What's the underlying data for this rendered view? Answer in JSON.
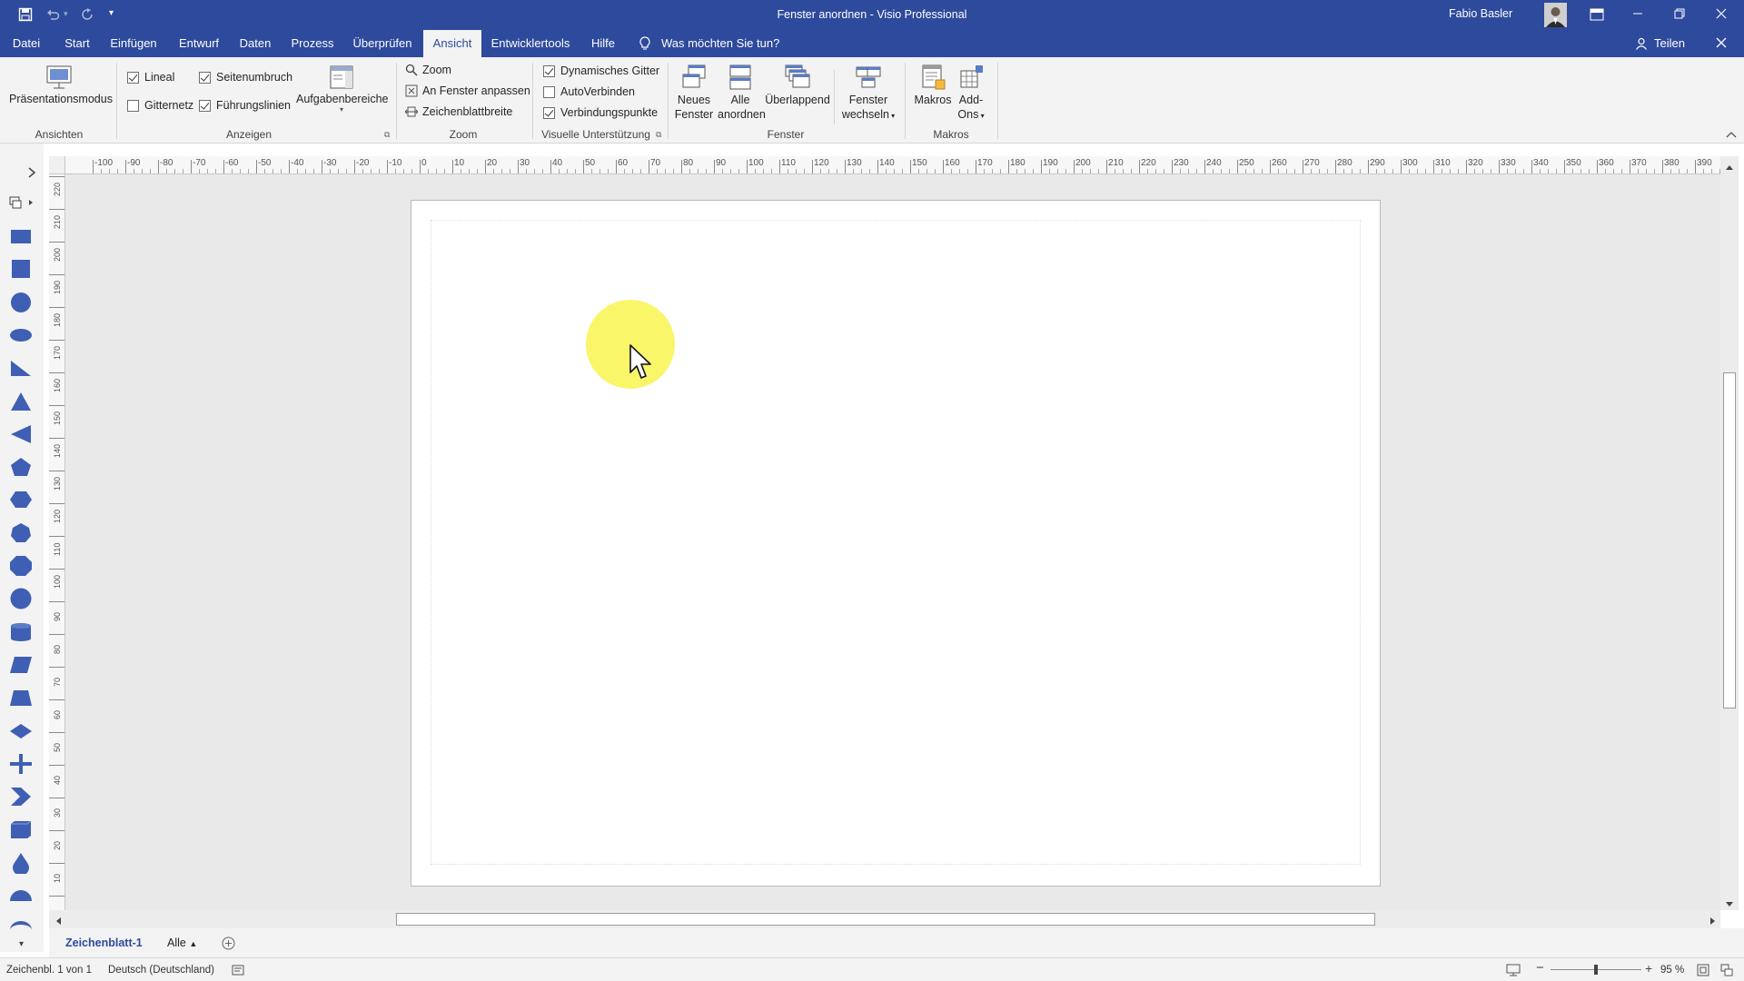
{
  "title_bar": {
    "window_title": "Fenster anordnen  -  Visio Professional",
    "user_name": "Fabio Basler",
    "colors": {
      "accent": "#2e4a9c"
    }
  },
  "tabs": [
    {
      "label": "Datei"
    },
    {
      "label": "Start"
    },
    {
      "label": "Einfügen"
    },
    {
      "label": "Entwurf"
    },
    {
      "label": "Daten"
    },
    {
      "label": "Prozess"
    },
    {
      "label": "Überprüfen"
    },
    {
      "label": "Ansicht",
      "active": true
    },
    {
      "label": "Entwicklertools"
    },
    {
      "label": "Hilfe"
    }
  ],
  "tell_me": "Was möchten Sie tun?",
  "share_label": "Teilen",
  "ribbon": {
    "ansichten": {
      "praesentationsmodus": "Präsentationsmodus",
      "group_label": "Ansichten"
    },
    "anzeigen": {
      "lineal": {
        "label": "Lineal",
        "checked": true
      },
      "seitenumbruch": {
        "label": "Seitenumbruch",
        "checked": true
      },
      "gitternetz": {
        "label": "Gitternetz",
        "checked": false
      },
      "fuehrungslinien": {
        "label": "Führungslinien",
        "checked": true
      },
      "aufgabenbereiche": "Aufgabenbereiche",
      "group_label": "Anzeigen"
    },
    "zoom": {
      "zoom": "Zoom",
      "fit": "An Fenster anpassen",
      "width": "Zeichenblattbreite",
      "group_label": "Zoom"
    },
    "visuelle": {
      "dyn_gitter": {
        "label": "Dynamisches Gitter",
        "checked": true
      },
      "autoverbinden": {
        "label": "AutoVerbinden",
        "checked": false
      },
      "verbindungspunkte": {
        "label": "Verbindungspunkte",
        "checked": true
      },
      "group_label": "Visuelle Unterstützung"
    },
    "fenster": {
      "neues_1": "Neues",
      "neues_2": "Fenster",
      "alle_1": "Alle",
      "alle_2": "anordnen",
      "ueberlappend": "Überlappend",
      "wechseln_1": "Fenster",
      "wechseln_2": "wechseln",
      "group_label": "Fenster"
    },
    "makros": {
      "makros": "Makros",
      "addons_1": "Add-",
      "addons_2": "Ons",
      "group_label": "Makros"
    }
  },
  "ruler": {
    "horizontal_ticks": [
      "-100",
      "-90",
      "-80",
      "-70",
      "-60",
      "-50",
      "-40",
      "-30",
      "-20",
      "-10",
      "0",
      "10",
      "20",
      "30",
      "40",
      "50",
      "60",
      "70",
      "80",
      "90",
      "100",
      "110",
      "120",
      "130",
      "140",
      "150",
      "160",
      "170",
      "180",
      "190",
      "200",
      "210",
      "220",
      "230",
      "240",
      "250",
      "260",
      "270",
      "280",
      "290",
      "300",
      "310",
      "320",
      "330",
      "340",
      "350",
      "360",
      "370",
      "380",
      "390"
    ],
    "vertical_ticks": [
      "220",
      "210",
      "200",
      "190",
      "180",
      "170",
      "160",
      "150",
      "140",
      "130",
      "120",
      "110",
      "100",
      "90",
      "80",
      "70",
      "60",
      "50",
      "40",
      "30",
      "20",
      "10",
      "0"
    ]
  },
  "shapes_panel": {
    "shapes": [
      "rectangle",
      "square",
      "circle",
      "ellipse",
      "right-triangle",
      "triangle",
      "left-triangle",
      "pentagon",
      "hexagon",
      "heptagon",
      "octagon",
      "decagon",
      "can",
      "parallelogram",
      "trapezoid",
      "diamond",
      "cross",
      "chevron",
      "cube",
      "drop",
      "half-circle",
      "crescent"
    ]
  },
  "sheet_tabs": {
    "active": "Zeichenblatt-1",
    "all": "Alle"
  },
  "status": {
    "page": "Zeichenbl. 1 von 1",
    "language": "Deutsch (Deutschland)",
    "zoom": "95 %",
    "zoom_fraction": 0.5
  }
}
